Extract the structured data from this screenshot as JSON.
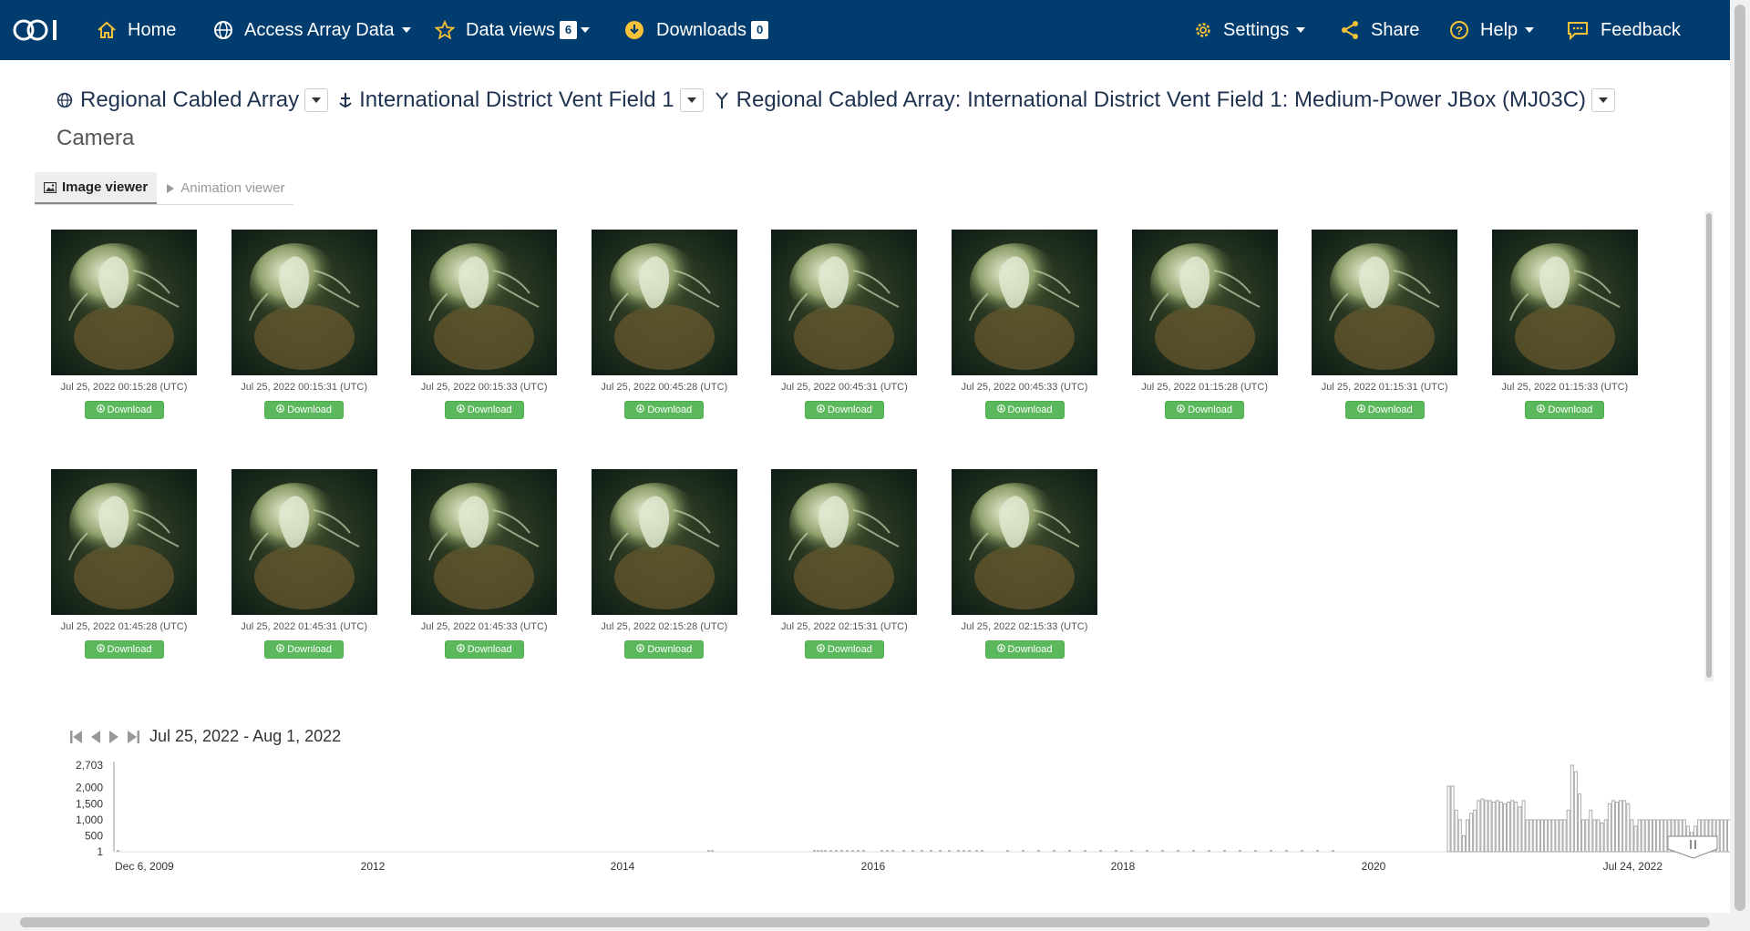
{
  "nav": {
    "logo_text": "OOI",
    "home": "Home",
    "access": "Access Array Data",
    "dataviews": "Data views",
    "dataviews_count": "6",
    "downloads": "Downloads",
    "downloads_count": "0",
    "settings": "Settings",
    "share": "Share",
    "help": "Help",
    "feedback": "Feedback"
  },
  "breadcrumb": {
    "array": "Regional Cabled Array",
    "site": "International District Vent Field 1",
    "node": "Regional Cabled Array: International District Vent Field 1: Medium-Power JBox (MJ03C)",
    "instrument": "Camera"
  },
  "tabs": {
    "image_viewer": "Image viewer",
    "animation_viewer": "Animation viewer"
  },
  "images": {
    "download_label": "Download",
    "items": [
      {
        "timestamp": "Jul 25, 2022 00:15:28 (UTC)"
      },
      {
        "timestamp": "Jul 25, 2022 00:15:31 (UTC)"
      },
      {
        "timestamp": "Jul 25, 2022 00:15:33 (UTC)"
      },
      {
        "timestamp": "Jul 25, 2022 00:45:28 (UTC)"
      },
      {
        "timestamp": "Jul 25, 2022 00:45:31 (UTC)"
      },
      {
        "timestamp": "Jul 25, 2022 00:45:33 (UTC)"
      },
      {
        "timestamp": "Jul 25, 2022 01:15:28 (UTC)"
      },
      {
        "timestamp": "Jul 25, 2022 01:15:31 (UTC)"
      },
      {
        "timestamp": "Jul 25, 2022 01:15:33 (UTC)"
      },
      {
        "timestamp": "Jul 25, 2022 01:45:28 (UTC)"
      },
      {
        "timestamp": "Jul 25, 2022 01:45:31 (UTC)"
      },
      {
        "timestamp": "Jul 25, 2022 01:45:33 (UTC)"
      },
      {
        "timestamp": "Jul 25, 2022 02:15:28 (UTC)"
      },
      {
        "timestamp": "Jul 25, 2022 02:15:31 (UTC)"
      },
      {
        "timestamp": "Jul 25, 2022 02:15:33 (UTC)"
      }
    ]
  },
  "timeline": {
    "range": "Jul 25, 2022 - Aug 1, 2022",
    "y_ticks": [
      "2,703",
      "2,000",
      "1,500",
      "1,000",
      "500",
      "1"
    ],
    "x_ticks": [
      "Dec 6, 2009",
      "2012",
      "2014",
      "2016",
      "2018",
      "2020",
      "Jul 24, 2022"
    ]
  },
  "chart_data": {
    "type": "bar",
    "title": "",
    "xlabel": "",
    "ylabel": "",
    "ylim": [
      1,
      2703
    ],
    "x_range": [
      "Dec 6, 2009",
      "Jul 24, 2022"
    ],
    "y_tick_labels": [
      "2,703",
      "2,000",
      "1,500",
      "1,000",
      "500",
      "1"
    ],
    "x_tick_labels": [
      "Dec 6, 2009",
      "2012",
      "2014",
      "2016",
      "2018",
      "2020",
      "Jul 24, 2022"
    ],
    "series": [
      {
        "values": [
          1,
          1,
          1,
          1,
          1,
          1,
          1,
          1,
          1,
          1,
          1,
          1,
          1,
          1,
          1,
          1,
          1,
          1,
          1,
          1,
          1,
          1,
          1,
          1,
          1,
          1,
          1,
          1,
          1,
          1,
          1,
          1,
          1,
          1,
          1,
          1,
          1,
          1,
          1,
          1,
          1,
          1,
          1,
          1,
          1,
          1,
          1,
          1,
          1,
          1,
          2050,
          2050,
          1300,
          1000,
          500,
          1000,
          1200,
          1300,
          1600,
          1650,
          1600,
          1600,
          1550,
          1600,
          1550,
          1500,
          1550,
          1600,
          1550,
          1400,
          1600,
          1000,
          1000,
          1000,
          1000,
          1000,
          1000,
          1000,
          1000,
          1000,
          1000,
          1000,
          1300,
          2703,
          2500,
          1800,
          1000,
          1000,
          1300,
          1000,
          1000,
          900,
          1000,
          1500,
          1600,
          1550,
          1600,
          1600,
          1500,
          1000,
          800,
          1000,
          1000,
          1000,
          1000,
          1000,
          1000,
          1000,
          1000,
          1000,
          1000,
          1000,
          1000,
          1000,
          800,
          600,
          800,
          1000,
          1000,
          1000,
          1000,
          1000,
          1000,
          1000,
          1000,
          1000,
          1000,
          1000
        ]
      }
    ],
    "legend": "none",
    "grid": false
  }
}
